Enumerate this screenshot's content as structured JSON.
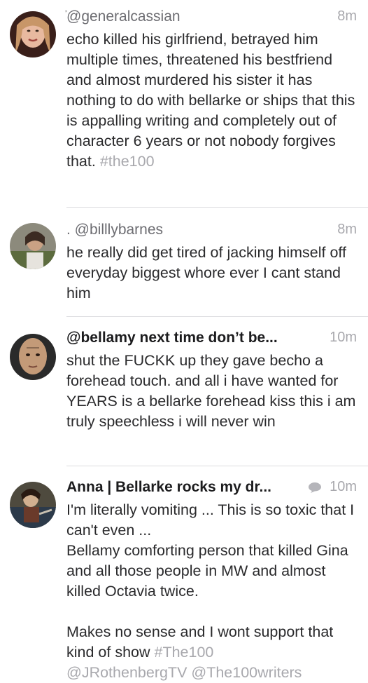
{
  "tweets": [
    {
      "handle": "@generalcassian",
      "time": "8m",
      "text": "echo killed his girlfriend, betrayed him multiple times, threatened his bestfriend and almost murdered his sister it has nothing to do with bellarke or ships that this is appalling writing and completely out of character 6 years or not nobody forgives that.",
      "hashtag": "#the100"
    },
    {
      "handle": ". @billlybarnes",
      "time": "8m",
      "text": "he really did get tired of jacking himself off everyday biggest whore ever I cant stand him"
    },
    {
      "handle": "@bellamy next time don’t be...",
      "time": "10m",
      "text": "shut the FUCKK up they gave becho a forehead touch. and all i have wanted for YEARS is a bellarke forehead kiss this i am truly speechless i will never win"
    },
    {
      "handle": "Anna | Bellarke rocks my dr...",
      "time": "10m",
      "text_line1": "I'm literally vomiting ... This is so toxic that I can't even ...",
      "text_line2": "Bellamy comforting person that killed Gina and all those people in MW and almost killed Octavia twice.",
      "text_line3": "Makes no sense and I wont support that kind of show",
      "hashtag": "#The100",
      "mentions": "@JRothenbergTV @The100writers"
    }
  ],
  "colors": {
    "secondary_text": "#a8a8ad",
    "divider": "#dcdcdf"
  }
}
